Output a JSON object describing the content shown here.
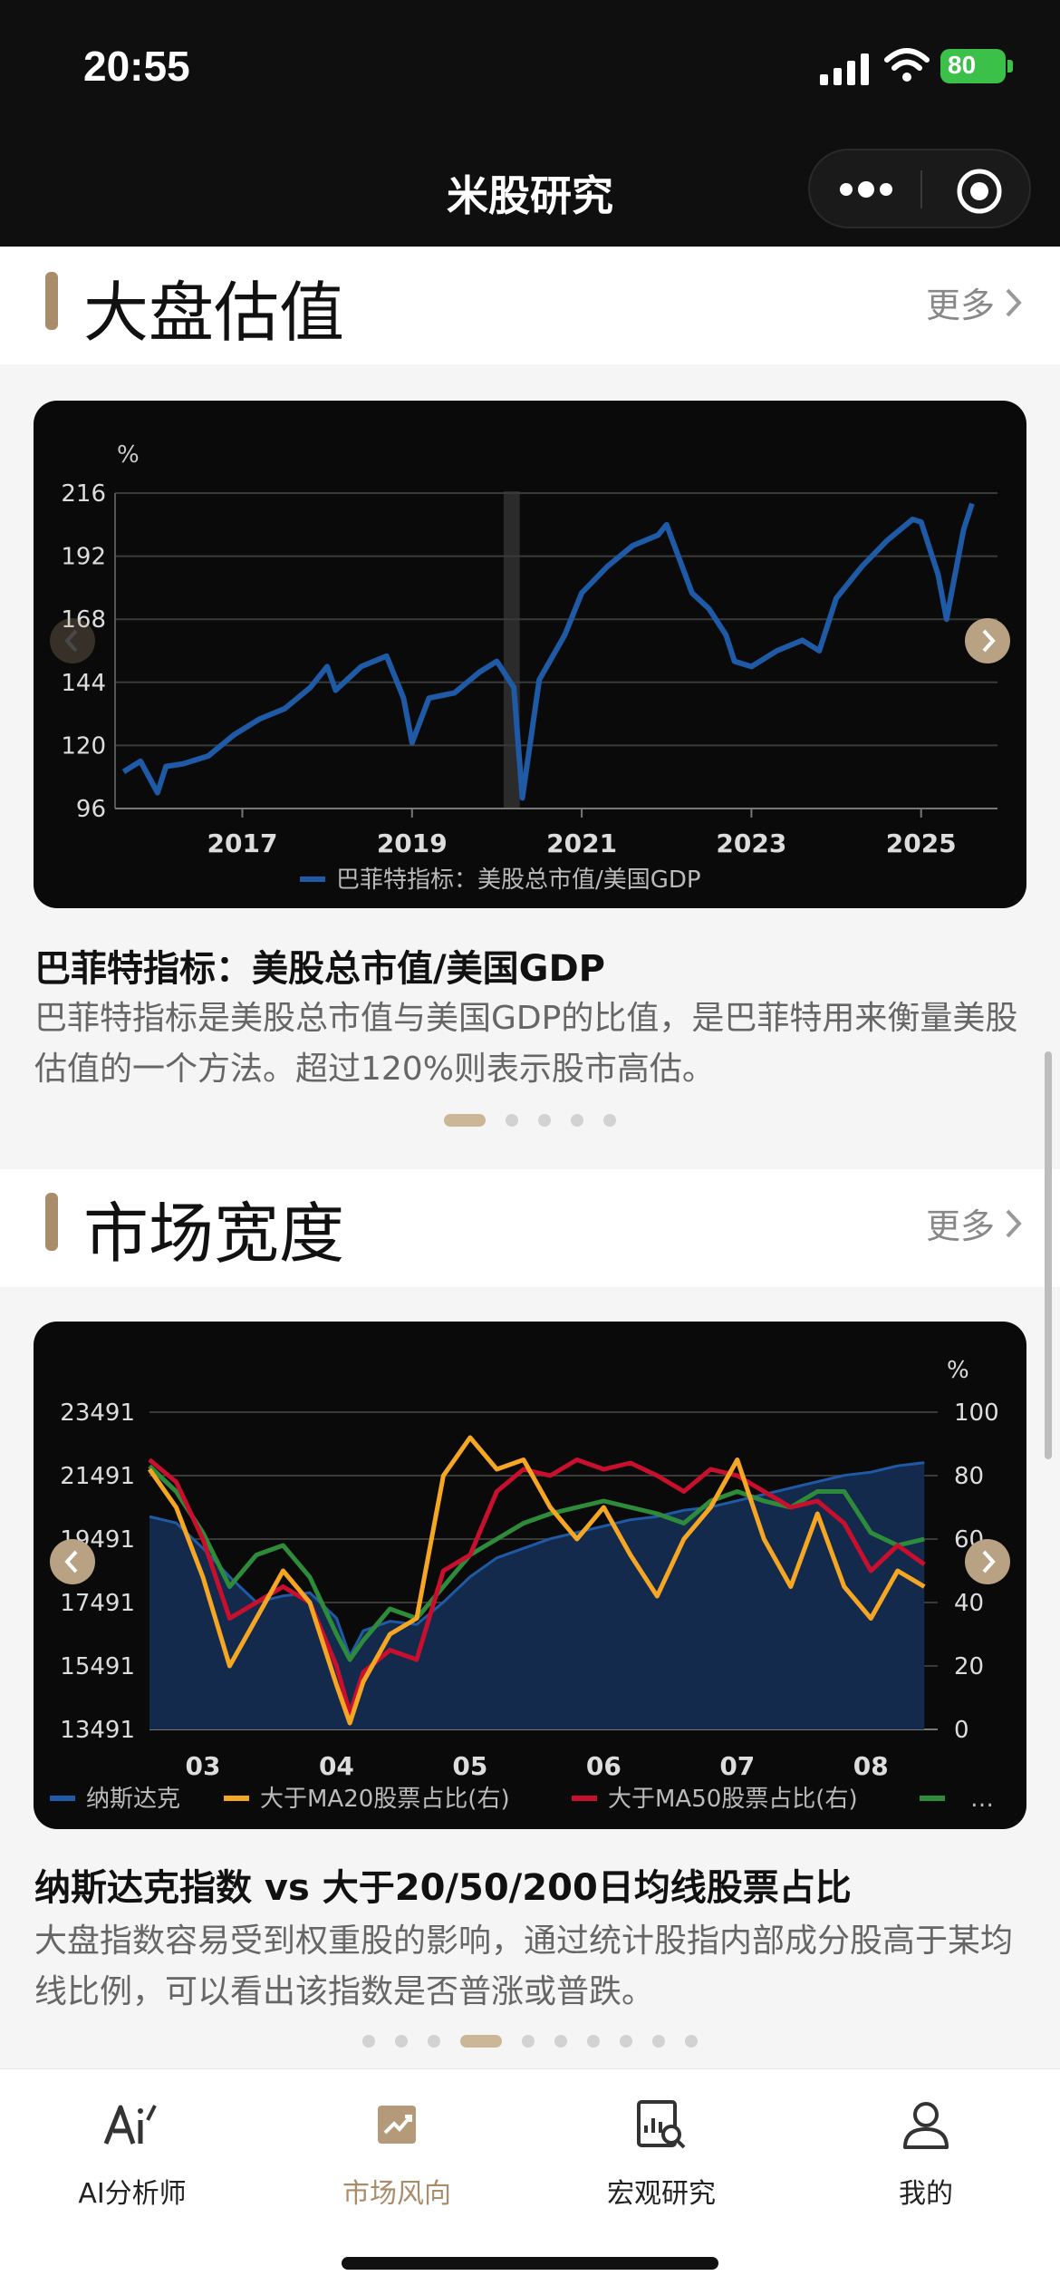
{
  "status": {
    "time": "20:55",
    "battery": "80"
  },
  "nav": {
    "title": "米股研究",
    "more_icon": "more-dots-icon",
    "close_icon": "target-icon"
  },
  "section1": {
    "title": "大盘估值",
    "more": "更多",
    "card_title": "巴菲特指标：美股总市值/美国GDP",
    "card_desc": "巴菲特指标是美股总市值与美国GDP的比值，是巴菲特用来衡量美股估值的一个方法。超过120%则表示股市高估。",
    "dots_count": 5,
    "active_dot": 0
  },
  "section2": {
    "title": "市场宽度",
    "more": "更多",
    "card_title": "纳斯达克指数 vs 大于20/50/200日均线股票占比",
    "card_desc": "大盘指数容易受到权重股的影响，通过统计股指内部成分股高于某均线比例，可以看出该指数是否普涨或普跌。",
    "dots_count": 10,
    "active_dot": 3
  },
  "chart_data": [
    {
      "type": "line",
      "ylabel": "%",
      "ylim": [
        96,
        216
      ],
      "y_ticks": [
        "216",
        "192",
        "168",
        "144",
        "120",
        "96"
      ],
      "x_ticks": [
        "2017",
        "2019",
        "2021",
        "2023",
        "2025"
      ],
      "legend": "巴菲特指标：美股总市值/美国GDP",
      "colors": {
        "series": "#1f5aa6"
      },
      "series": [
        {
          "name": "巴菲特指标：美股总市值/美国GDP",
          "x": [
            2015.6,
            2015.8,
            2016.0,
            2016.1,
            2016.3,
            2016.6,
            2016.9,
            2017.2,
            2017.5,
            2017.8,
            2018.0,
            2018.1,
            2018.4,
            2018.7,
            2018.9,
            2019.0,
            2019.2,
            2019.5,
            2019.8,
            2020.0,
            2020.2,
            2020.3,
            2020.5,
            2020.8,
            2021.0,
            2021.3,
            2021.6,
            2021.9,
            2022.0,
            2022.3,
            2022.5,
            2022.7,
            2022.8,
            2023.0,
            2023.3,
            2023.6,
            2023.8,
            2024.0,
            2024.3,
            2024.6,
            2024.9,
            2025.0,
            2025.2,
            2025.3,
            2025.5,
            2025.6
          ],
          "values": [
            110,
            114,
            102,
            112,
            113,
            116,
            124,
            130,
            134,
            142,
            150,
            141,
            150,
            154,
            138,
            121,
            138,
            140,
            148,
            152,
            142,
            100,
            145,
            162,
            178,
            188,
            196,
            200,
            204,
            178,
            172,
            162,
            152,
            150,
            156,
            160,
            156,
            176,
            188,
            198,
            206,
            205,
            185,
            168,
            202,
            212
          ]
        }
      ]
    },
    {
      "type": "line",
      "ylabel_right": "%",
      "ylim": [
        13491,
        23491
      ],
      "ylim_right": [
        0,
        100
      ],
      "y_ticks": [
        "23491",
        "21491",
        "19491",
        "17491",
        "15491",
        "13491"
      ],
      "y_ticks_right": [
        "100",
        "80",
        "60",
        "40",
        "20",
        "0"
      ],
      "x_ticks": [
        "03",
        "04",
        "05",
        "06",
        "07",
        "08"
      ],
      "legend": [
        "纳斯达克",
        "大于MA20股票占比(右)",
        "大于MA50股票占比(右)"
      ],
      "legend_more": "…",
      "colors": {
        "nasdaq": "#1f5aa6",
        "ma20": "#f5a623",
        "ma50": "#c8102e",
        "ma200": "#2e8b3a"
      },
      "x": [
        2.6,
        2.8,
        3.0,
        3.2,
        3.4,
        3.6,
        3.8,
        4.0,
        4.1,
        4.2,
        4.4,
        4.6,
        4.8,
        5.0,
        5.2,
        5.4,
        5.6,
        5.8,
        6.0,
        6.2,
        6.4,
        6.6,
        6.8,
        7.0,
        7.2,
        7.4,
        7.6,
        7.8,
        8.0,
        8.2,
        8.4
      ],
      "series": [
        {
          "name": "纳斯达克",
          "values": [
            20200,
            20000,
            19200,
            18300,
            17500,
            17700,
            17800,
            17000,
            15800,
            16600,
            16900,
            16800,
            17500,
            18300,
            18900,
            19200,
            19500,
            19700,
            19900,
            20100,
            20200,
            20400,
            20500,
            20700,
            20900,
            21100,
            21300,
            21500,
            21600,
            21800,
            21900
          ]
        },
        {
          "name": "大于MA20股票占比(右)",
          "values": [
            82,
            70,
            48,
            20,
            35,
            50,
            40,
            14,
            2,
            15,
            30,
            35,
            80,
            92,
            82,
            85,
            70,
            60,
            70,
            55,
            42,
            60,
            70,
            85,
            60,
            45,
            68,
            45,
            35,
            50,
            45
          ]
        },
        {
          "name": "大于MA50股票占比(右)",
          "values": [
            85,
            78,
            60,
            35,
            40,
            45,
            40,
            20,
            5,
            18,
            25,
            22,
            50,
            55,
            75,
            82,
            80,
            85,
            82,
            84,
            80,
            75,
            82,
            80,
            75,
            70,
            72,
            65,
            50,
            58,
            52
          ]
        },
        {
          "name": "",
          "values": [
            83,
            75,
            62,
            45,
            55,
            58,
            48,
            30,
            22,
            28,
            38,
            35,
            45,
            55,
            60,
            65,
            68,
            70,
            72,
            70,
            68,
            65,
            72,
            75,
            72,
            70,
            75,
            75,
            62,
            58,
            60
          ]
        }
      ]
    }
  ],
  "tabs": [
    {
      "label": "AI分析师",
      "icon": "ai-analyst-icon",
      "active": false
    },
    {
      "label": "市场风向",
      "icon": "trend-icon",
      "active": true
    },
    {
      "label": "宏观研究",
      "icon": "macro-research-icon",
      "active": false
    },
    {
      "label": "我的",
      "icon": "profile-icon",
      "active": false
    }
  ]
}
